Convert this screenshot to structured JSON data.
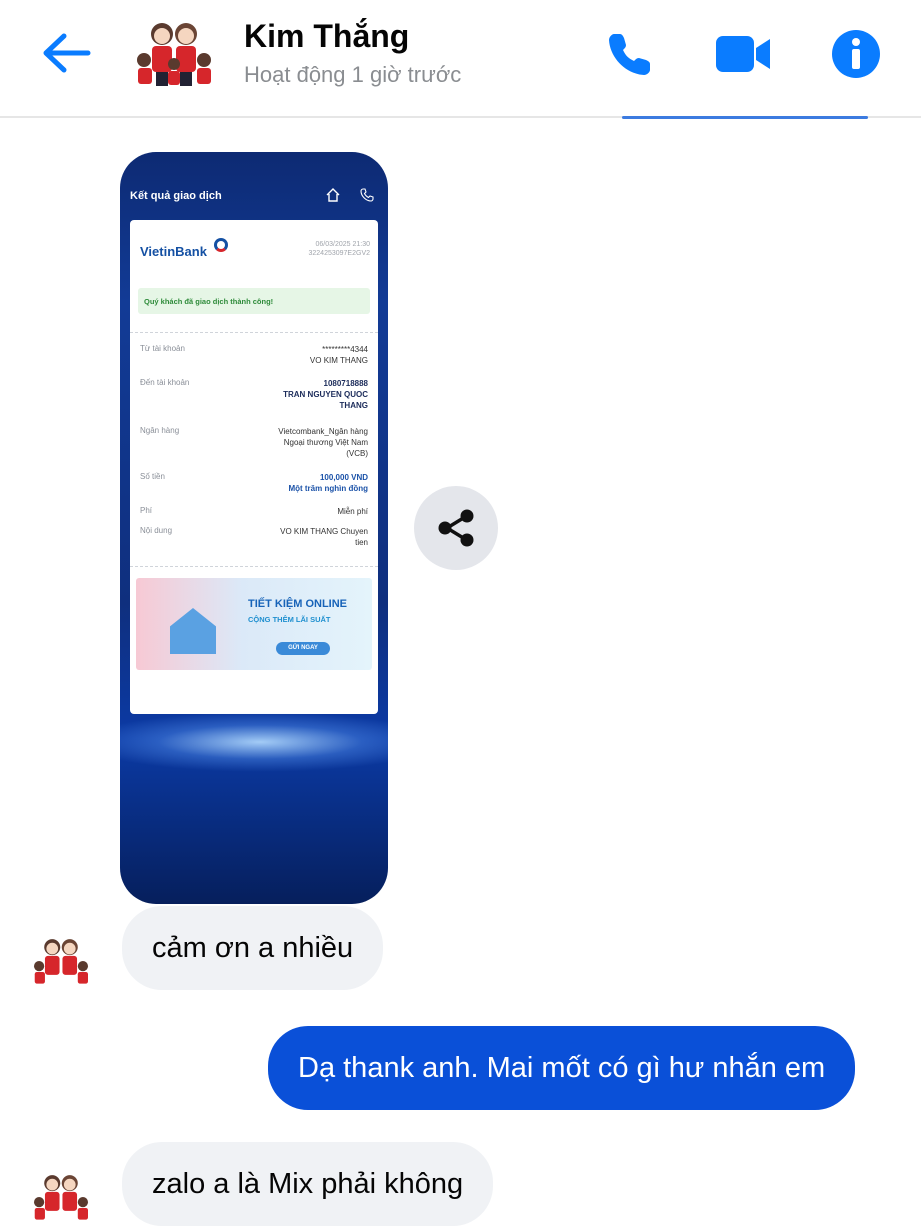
{
  "header": {
    "contact_name": "Kim Thắng",
    "status": "Hoạt động 1 giờ trước",
    "back_icon": "arrow-left-icon",
    "call_icon": "phone-icon",
    "video_icon": "video-icon",
    "info_icon": "info-icon",
    "accent": "#0a7cff"
  },
  "receipt": {
    "screen_title": "Kết quả giao dịch",
    "bank_logo": "VietinBank",
    "datetime": "06/03/2025 21:30",
    "ref": "3224253097E2GV2",
    "success_text": "Quý khách đã giao dịch thành công!",
    "rows": [
      {
        "label": "Từ tài khoản",
        "value": "*********4344",
        "value2": "VO KIM THANG"
      },
      {
        "label": "Đến tài khoản",
        "value": "1080718888",
        "value2": "TRAN NGUYEN QUOC",
        "value3": "THANG"
      },
      {
        "label": "Ngân hàng",
        "value": "Vietcombank_Ngân hàng",
        "value2": "Ngoại thương Việt Nam",
        "value3": "(VCB)"
      },
      {
        "label": "Số tiền",
        "value": "100,000 VND",
        "value2": "Một trăm nghìn đồng"
      },
      {
        "label": "Phí",
        "value": "Miễn phí"
      },
      {
        "label": "Nội dung",
        "value": "VO KIM THANG Chuyen",
        "value2": "tien"
      }
    ],
    "banner_title": "TIẾT KIỆM ONLINE",
    "banner_sub": "CỘNG THÊM LÃI SUẤT",
    "banner_button": "GỬI NGAY"
  },
  "messages": {
    "m1": "cảm ơn a nhiều",
    "m2": "Dạ thank anh. Mai mốt có gì hư nhắn em",
    "m3": "zalo a là Mix phải không"
  },
  "share_icon": "share-icon"
}
